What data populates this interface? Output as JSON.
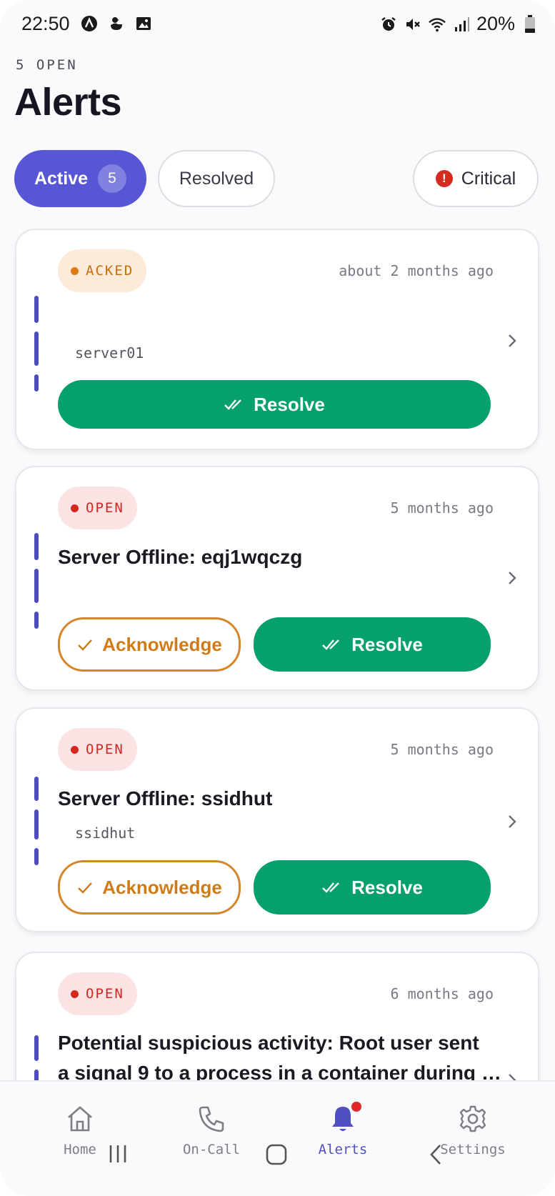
{
  "status_bar": {
    "time": "22:50",
    "battery": "20%",
    "left_icons": [
      "app-a-icon",
      "duck-icon",
      "image-icon"
    ],
    "right_icons": [
      "alarm-icon",
      "mute-icon",
      "wifi-icon",
      "signal-icon",
      "battery-icon"
    ]
  },
  "header": {
    "overline": "5 OPEN",
    "title": "Alerts"
  },
  "filters": {
    "active_label": "Active",
    "active_count": "5",
    "resolved_label": "Resolved",
    "critical_label": "Critical"
  },
  "alerts": [
    {
      "status": "ACKED",
      "time": "about 2 months ago",
      "title": "",
      "host": "server01",
      "resolve_label": "Resolve"
    },
    {
      "status": "OPEN",
      "time": "5 months ago",
      "title": "Server Offline: eqj1wqczg",
      "host": "",
      "acknowledge_label": "Acknowledge",
      "resolve_label": "Resolve"
    },
    {
      "status": "OPEN",
      "time": "5 months ago",
      "title": "Server Offline: ssidhut",
      "host": "ssidhut",
      "acknowledge_label": "Acknowledge",
      "resolve_label": "Resolve"
    },
    {
      "status": "OPEN",
      "time": "6 months ago",
      "title_line1": "Potential suspicious activity: Root user sent",
      "title_line2": "a signal 9 to a process in a container during …"
    }
  ],
  "nav": {
    "items": [
      {
        "label": "Home",
        "icon": "home-icon"
      },
      {
        "label": "On-Call",
        "icon": "phone-icon"
      },
      {
        "label": "Alerts",
        "icon": "bell-icon"
      },
      {
        "label": "Settings",
        "icon": "gear-icon"
      }
    ]
  },
  "colors": {
    "accent": "#5757d6",
    "resolve": "#05a06e",
    "acknowledge": "#d5862a",
    "open": "#d4271e",
    "acked": "#d97a15"
  }
}
